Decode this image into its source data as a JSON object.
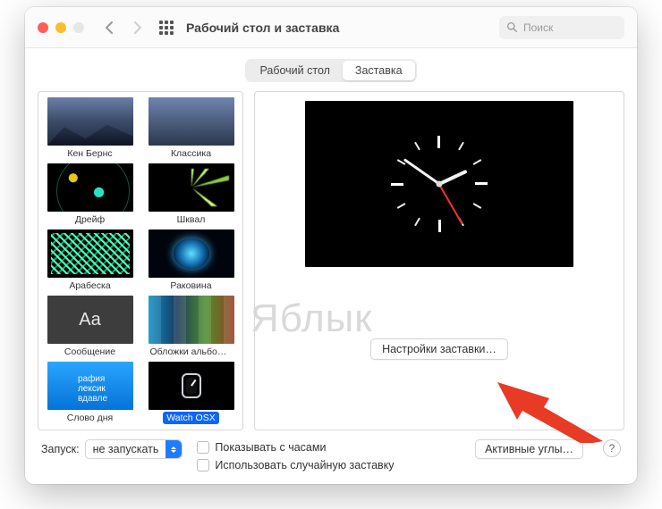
{
  "window": {
    "title": "Рабочий стол и заставка"
  },
  "search": {
    "placeholder": "Поиск"
  },
  "tabs": {
    "desktop": "Рабочий стол",
    "screensaver": "Заставка"
  },
  "screensavers": [
    {
      "key": "kenburns",
      "label": "Кен Бернс"
    },
    {
      "key": "classic",
      "label": "Классика"
    },
    {
      "key": "drift",
      "label": "Дрейф"
    },
    {
      "key": "squall",
      "label": "Шквал"
    },
    {
      "key": "arabesque",
      "label": "Арабеска"
    },
    {
      "key": "shell",
      "label": "Раковина"
    },
    {
      "key": "message",
      "label": "Сообщение"
    },
    {
      "key": "albums",
      "label": "Обложки альбомов"
    },
    {
      "key": "word",
      "label": "Слово дня"
    },
    {
      "key": "watchosx",
      "label": "Watch OSX",
      "selected": true
    }
  ],
  "message_thumb_text": "Aa",
  "word_thumb_lines": [
    "рафия",
    "лексик",
    "вдавле"
  ],
  "settings_button": "Настройки заставки…",
  "footer": {
    "launch_label": "Запуск:",
    "launch_value": "не запускать",
    "show_clock": "Показывать с часами",
    "random": "Использовать случайную заставку",
    "hot_corners": "Активные углы…",
    "help": "?"
  },
  "watermark": "Яблык",
  "colors": {
    "accent": "#0a66ff"
  }
}
